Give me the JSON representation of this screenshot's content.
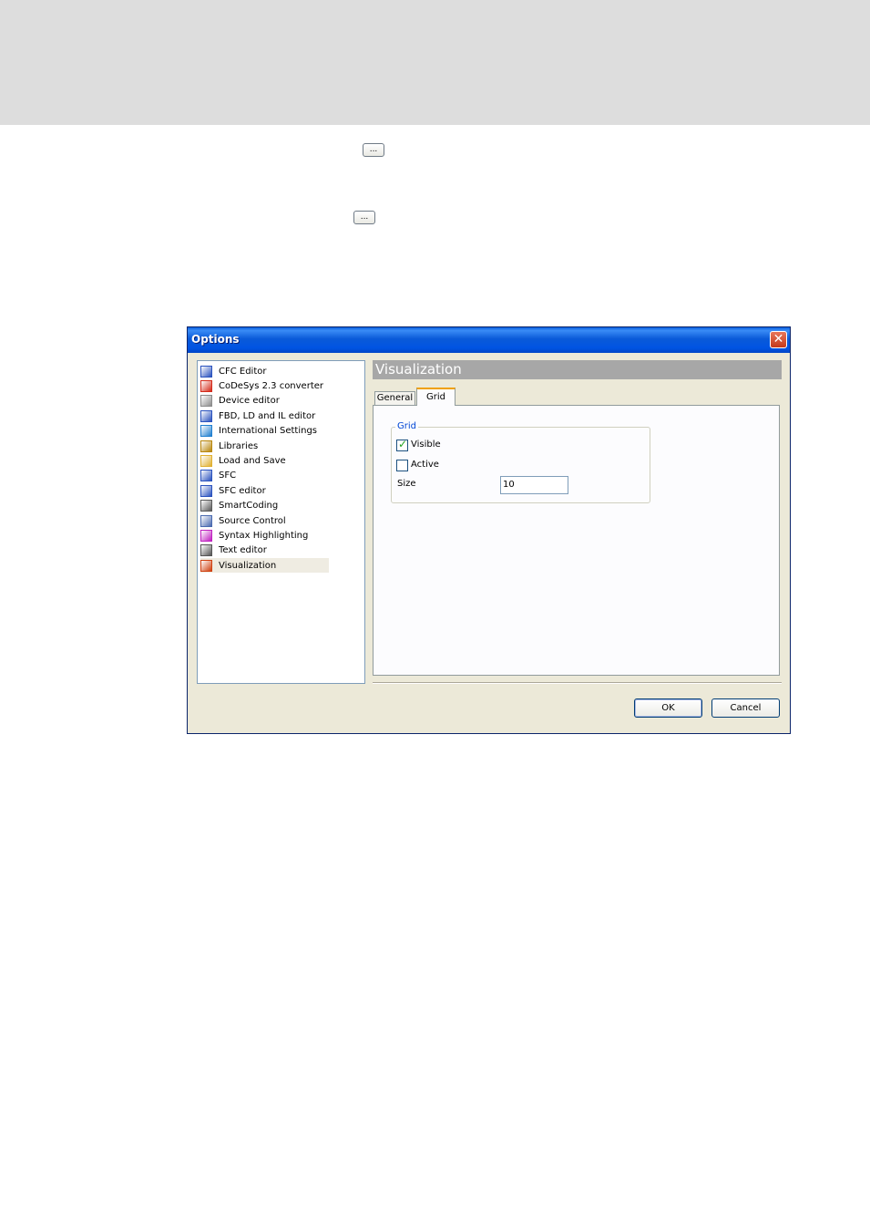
{
  "ellipsis_buttons": [
    "...",
    "..."
  ],
  "dialog": {
    "title": "Options",
    "close_glyph": "✕",
    "tree": {
      "items": [
        {
          "label": "CFC Editor",
          "icon": "cfc-editor-icon",
          "color": "#2a52be"
        },
        {
          "label": "CoDeSys 2.3 converter",
          "icon": "converter-icon",
          "color": "#d42a1a"
        },
        {
          "label": "Device editor",
          "icon": "device-editor-icon",
          "color": "#8c8c8c"
        },
        {
          "label": "FBD, LD and IL editor",
          "icon": "fbd-ld-il-editor-icon",
          "color": "#2a52be"
        },
        {
          "label": "International Settings",
          "icon": "globe-icon",
          "color": "#1f7fd0"
        },
        {
          "label": "Libraries",
          "icon": "libraries-icon",
          "color": "#b8860b"
        },
        {
          "label": "Load and Save",
          "icon": "folder-icon",
          "color": "#e0b030"
        },
        {
          "label": "SFC",
          "icon": "sfc-icon",
          "color": "#2a52be"
        },
        {
          "label": "SFC editor",
          "icon": "sfc-editor-icon",
          "color": "#2a52be"
        },
        {
          "label": "SmartCoding",
          "icon": "smartcoding-icon",
          "color": "#5a5a5a"
        },
        {
          "label": "Source Control",
          "icon": "source-control-icon",
          "color": "#4a6ab0"
        },
        {
          "label": "Syntax Highlighting",
          "icon": "syntax-highlighting-icon",
          "color": "#c020c0"
        },
        {
          "label": "Text editor",
          "icon": "text-editor-icon",
          "color": "#555555"
        },
        {
          "label": "Visualization",
          "icon": "visualization-icon",
          "color": "#d04010"
        }
      ],
      "selected": "Visualization"
    },
    "section_title": "Visualization",
    "tabs": [
      {
        "label": "General",
        "active": false
      },
      {
        "label": "Grid",
        "active": true
      }
    ],
    "grid_group": {
      "title": "Grid",
      "visible": {
        "label": "Visible",
        "checked": true
      },
      "active": {
        "label": "Active",
        "checked": false
      },
      "size": {
        "label": "Size",
        "value": "10"
      }
    },
    "ok_label": "OK",
    "cancel_label": "Cancel"
  }
}
